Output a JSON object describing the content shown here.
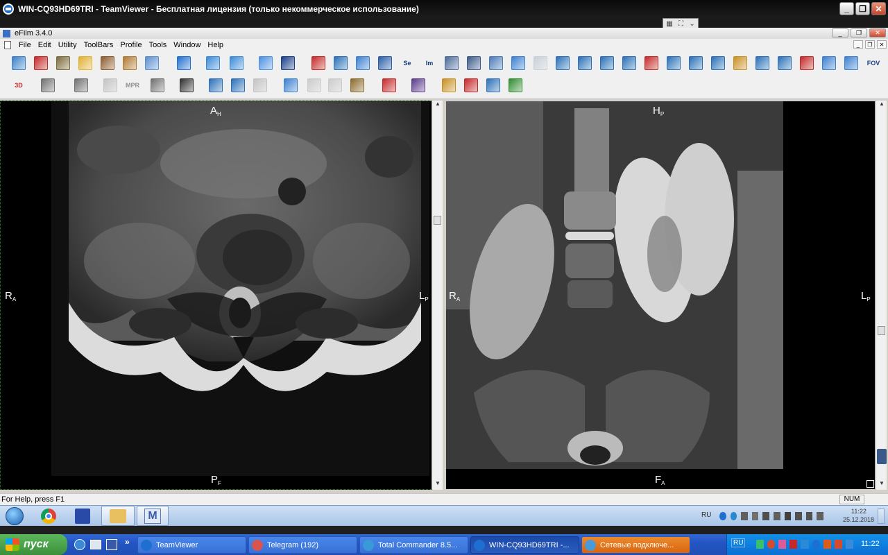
{
  "tv_window": {
    "title": "WIN-CQ93HD69TRI - TeamViewer - Бесплатная лицензия (только некоммерческое использование)",
    "min_glyph": "_",
    "max_glyph": "❐",
    "close_glyph": "✕"
  },
  "app": {
    "title": "eFilm 3.4.0",
    "menu": [
      "File",
      "Edit",
      "Utility",
      "ToolBars",
      "Profile",
      "Tools",
      "Window",
      "Help"
    ]
  },
  "toolbar": {
    "row1": [
      {
        "icon": "new-study-icon",
        "color": "#3b7fc9"
      },
      {
        "icon": "delete-icon",
        "color": "#c62828"
      },
      {
        "icon": "hourglass-icon",
        "color": "#7b6a3a"
      },
      {
        "icon": "open-folder-icon",
        "color": "#e0b030"
      },
      {
        "icon": "patient-icon",
        "color": "#8b5a2b"
      },
      {
        "icon": "export-icon",
        "color": "#b07830"
      },
      {
        "icon": "windows-icon",
        "color": "#5a8fd0"
      },
      {
        "icon": "window-level-icon",
        "color": "#1f6fd0"
      },
      {
        "icon": "pan-icon",
        "color": "#3a8ad8"
      },
      {
        "icon": "zoom-icon",
        "color": "#3a8ad8"
      },
      {
        "icon": "back-arrow-icon",
        "color": "#4a90e0"
      },
      {
        "icon": "text-annotation-icon",
        "color": "#1a3f8a"
      },
      {
        "icon": "edit-annotation-icon",
        "color": "#c62828"
      },
      {
        "icon": "cine-icon",
        "color": "#2a6fb8"
      },
      {
        "icon": "tile-layout-icon",
        "color": "#3a7fd0"
      },
      {
        "icon": "compare-icon",
        "color": "#2a5fa8"
      },
      {
        "icon": "series-icon",
        "color": "#2a5fa8"
      },
      {
        "icon": "image-icon",
        "color": "#2a5fa8"
      },
      {
        "icon": "report-icon",
        "color": "#4a6a9a"
      },
      {
        "icon": "eye-icon",
        "color": "#3a5a8a"
      },
      {
        "icon": "ruler-icon",
        "color": "#4a7ab8"
      },
      {
        "icon": "stack-icon",
        "color": "#3a7fd0"
      },
      {
        "icon": "stack-dim-icon",
        "color": "#9aa8c0"
      },
      {
        "icon": "line-icon",
        "color": "#2a6fb8"
      },
      {
        "icon": "angle-icon",
        "color": "#2a6fb8"
      },
      {
        "icon": "ellipse-icon",
        "color": "#2a6fb8"
      },
      {
        "icon": "probe-icon",
        "color": "#2a6fb8"
      },
      {
        "icon": "erase-icon",
        "color": "#c62828"
      },
      {
        "icon": "spine-label-icon",
        "color": "#2a6fb8"
      },
      {
        "icon": "spine-label-alt-icon",
        "color": "#2a6fb8"
      },
      {
        "icon": "link-icon",
        "color": "#2a6fb8"
      },
      {
        "icon": "hand-icon",
        "color": "#c89020"
      },
      {
        "icon": "magic-icon",
        "color": "#2a6fb8"
      },
      {
        "icon": "height-icon",
        "color": "#2a6fb8"
      },
      {
        "icon": "crosshair-icon",
        "color": "#c62828"
      },
      {
        "icon": "flip-horizontal-icon",
        "color": "#3a7fd0"
      },
      {
        "icon": "flip-vertical-icon",
        "color": "#3a7fd0"
      },
      {
        "icon": "fov-icon",
        "color": "#1a3f8a"
      }
    ],
    "row2": [
      {
        "icon": "3d-icon",
        "color": "#c62828"
      },
      {
        "icon": "gray-box-icon",
        "color": "#707070"
      },
      {
        "icon": "axis-icon",
        "color": "#707070"
      },
      {
        "icon": "glasses-icon",
        "color": "#909090"
      },
      {
        "icon": "mpr-icon",
        "color": "#909090"
      },
      {
        "icon": "histogram-icon",
        "color": "#707070"
      },
      {
        "icon": "traffic-icon",
        "color": "#303030"
      },
      {
        "icon": "save-image-icon",
        "color": "#2a6fb8"
      },
      {
        "icon": "save-series-icon",
        "color": "#2a6fb8"
      },
      {
        "icon": "close-image-icon",
        "color": "#909090"
      },
      {
        "icon": "sync-icon",
        "color": "#3a7fd0"
      },
      {
        "icon": "prev-icon",
        "color": "#a0a0a0"
      },
      {
        "icon": "next-icon",
        "color": "#a0a0a0"
      },
      {
        "icon": "print-icon",
        "color": "#8a6a2a"
      },
      {
        "icon": "compare-dropdown-icon",
        "color": "#c62828"
      },
      {
        "icon": "monitor-icon",
        "color": "#5a3a8a"
      },
      {
        "icon": "key-image-icon",
        "color": "#c89020"
      },
      {
        "icon": "reset-icon",
        "color": "#c62828"
      },
      {
        "icon": "scout-icon",
        "color": "#2a6fb8"
      },
      {
        "icon": "check-icon",
        "color": "#2e8b2e"
      }
    ],
    "mpr_label": "MPR",
    "fov_label": "FOV",
    "se_label": "Se",
    "im_label": "Im",
    "threed_label": "3D"
  },
  "viewports": [
    {
      "name": "axial",
      "top": {
        "main": "A",
        "sub": "H"
      },
      "bottom": {
        "main": "P",
        "sub": "F"
      },
      "left": {
        "main": "R",
        "sub": "A"
      },
      "right": {
        "main": "L",
        "sub": "P"
      }
    },
    {
      "name": "coronal",
      "top": {
        "main": "H",
        "sub": "P"
      },
      "bottom": {
        "main": "F",
        "sub": "A"
      },
      "left": {
        "main": "R",
        "sub": "A"
      },
      "right": {
        "main": "L",
        "sub": "P"
      }
    }
  ],
  "statusbar": {
    "help": "For Help, press F1",
    "num": "NUM"
  },
  "remote_taskbar": {
    "lang": "RU",
    "time": "11:22",
    "date": "25.12.2018"
  },
  "local_taskbar": {
    "start": "пуск",
    "tasks": [
      {
        "label": "TeamViewer",
        "color": "#1e6fd0"
      },
      {
        "label": "Telegram (192)",
        "color": "#d9534f"
      },
      {
        "label": "Total Commander 8.5...",
        "color": "#3a9ad9"
      },
      {
        "label": "WIN-CQ93HD69TRI -...",
        "color": "#1e6fd0"
      },
      {
        "label": "Сетевые подключе...",
        "color": "#4a9ad9"
      }
    ],
    "lang": "RU",
    "time": "11:22",
    "chevron": "»"
  }
}
